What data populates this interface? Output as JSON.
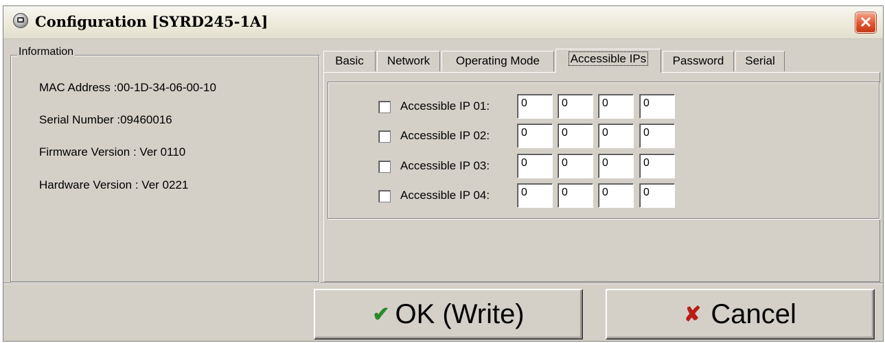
{
  "window": {
    "title": "Configuration [SYRD245-1A]",
    "close_glyph": "✕"
  },
  "information": {
    "legend": "Information",
    "mac": "MAC Address :00-1D-34-06-00-10",
    "serial": "Serial Number :09460016",
    "firmware": "Firmware Version : Ver 0110",
    "hardware": "Hardware Version : Ver 0221"
  },
  "tabs": [
    {
      "label": "Basic"
    },
    {
      "label": "Network"
    },
    {
      "label": "Operating Mode"
    },
    {
      "label": "Accessible IPs"
    },
    {
      "label": "Password"
    },
    {
      "label": "Serial"
    }
  ],
  "active_tab": "Accessible IPs",
  "accessible_ips": [
    {
      "label": "Accessible IP 01:",
      "checked": false,
      "octets": [
        "0",
        "0",
        "0",
        "0"
      ]
    },
    {
      "label": "Accessible IP 02:",
      "checked": false,
      "octets": [
        "0",
        "0",
        "0",
        "0"
      ]
    },
    {
      "label": "Accessible IP 03:",
      "checked": false,
      "octets": [
        "0",
        "0",
        "0",
        "0"
      ]
    },
    {
      "label": "Accessible IP 04:",
      "checked": false,
      "octets": [
        "0",
        "0",
        "0",
        "0"
      ]
    }
  ],
  "buttons": {
    "ok_icon": "✔",
    "ok_label": "OK (Write)",
    "cancel_icon": "✘",
    "cancel_label": "Cancel"
  },
  "colors": {
    "dialog_bg": "#d4d0c8",
    "ok_icon": "#2a8a2a",
    "cancel_icon": "#b81d16",
    "close_button": "#e3542e"
  },
  "icons": {
    "app": "device-icon",
    "close": "close-icon",
    "ok": "checkmark-icon",
    "cancel": "x-icon"
  }
}
